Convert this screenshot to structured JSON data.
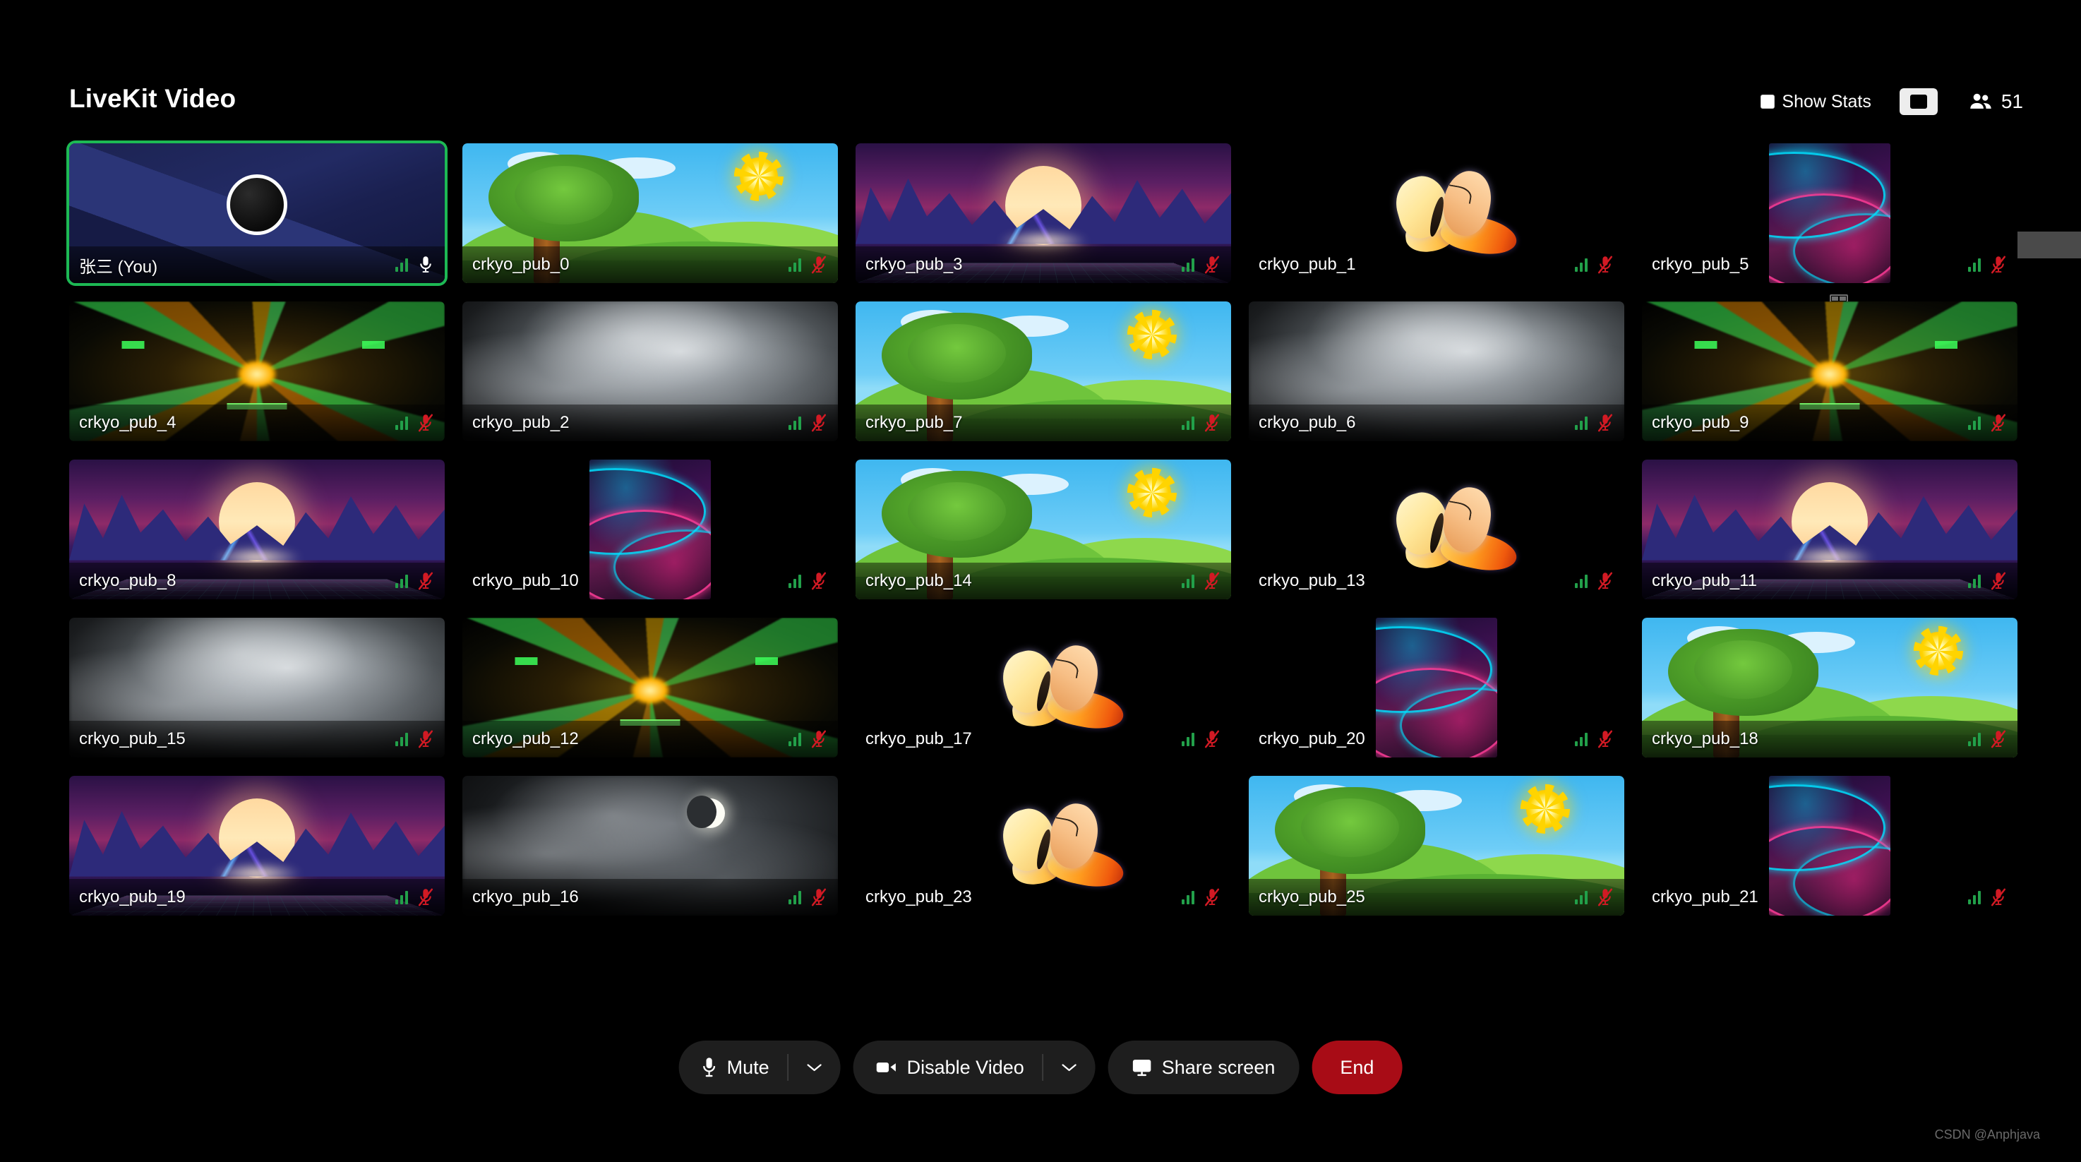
{
  "header": {
    "app_title": "LiveKit Video",
    "show_stats_label": "Show Stats",
    "show_stats_checked": false,
    "layout_grid_name": "grid-layout",
    "layout_speaker_name": "speaker-layout",
    "participant_count": "51"
  },
  "tiles": [
    {
      "name": "张三 (You)",
      "scene": "obs",
      "muted": false,
      "active": true,
      "fit": "wide"
    },
    {
      "name": "crkyo_pub_0",
      "scene": "meadow",
      "muted": true,
      "active": false,
      "fit": "wide"
    },
    {
      "name": "crkyo_pub_3",
      "scene": "synth",
      "muted": true,
      "active": false,
      "fit": "wide"
    },
    {
      "name": "crkyo_pub_1",
      "scene": "bfly",
      "muted": true,
      "active": false,
      "fit": "wide"
    },
    {
      "name": "crkyo_pub_5",
      "scene": "neon",
      "muted": true,
      "active": false,
      "fit": "narrow"
    },
    {
      "name": "crkyo_pub_4",
      "scene": "kal",
      "muted": true,
      "active": false,
      "fit": "wide"
    },
    {
      "name": "crkyo_pub_2",
      "scene": "cloud",
      "muted": true,
      "active": false,
      "fit": "wide"
    },
    {
      "name": "crkyo_pub_7",
      "scene": "meadow",
      "muted": true,
      "active": false,
      "fit": "wide"
    },
    {
      "name": "crkyo_pub_6",
      "scene": "cloud",
      "muted": true,
      "active": false,
      "fit": "wide"
    },
    {
      "name": "crkyo_pub_9",
      "scene": "kal",
      "muted": true,
      "active": false,
      "fit": "wide"
    },
    {
      "name": "crkyo_pub_8",
      "scene": "synth",
      "muted": true,
      "active": false,
      "fit": "wide"
    },
    {
      "name": "crkyo_pub_10",
      "scene": "neon",
      "muted": true,
      "active": false,
      "fit": "narrow"
    },
    {
      "name": "crkyo_pub_14",
      "scene": "meadow",
      "muted": true,
      "active": false,
      "fit": "wide"
    },
    {
      "name": "crkyo_pub_13",
      "scene": "bfly",
      "muted": true,
      "active": false,
      "fit": "wide"
    },
    {
      "name": "crkyo_pub_11",
      "scene": "synth",
      "muted": true,
      "active": false,
      "fit": "wide"
    },
    {
      "name": "crkyo_pub_15",
      "scene": "cloud",
      "muted": true,
      "active": false,
      "fit": "wide"
    },
    {
      "name": "crkyo_pub_12",
      "scene": "kal",
      "muted": true,
      "active": false,
      "fit": "wide"
    },
    {
      "name": "crkyo_pub_17",
      "scene": "bfly",
      "muted": true,
      "active": false,
      "fit": "wide"
    },
    {
      "name": "crkyo_pub_20",
      "scene": "neon",
      "muted": true,
      "active": false,
      "fit": "narrow"
    },
    {
      "name": "crkyo_pub_18",
      "scene": "meadow",
      "muted": true,
      "active": false,
      "fit": "wide"
    },
    {
      "name": "crkyo_pub_19",
      "scene": "synth",
      "muted": true,
      "active": false,
      "fit": "wide"
    },
    {
      "name": "crkyo_pub_16",
      "scene": "moon",
      "muted": true,
      "active": false,
      "fit": "wide"
    },
    {
      "name": "crkyo_pub_23",
      "scene": "bfly",
      "muted": true,
      "active": false,
      "fit": "wide"
    },
    {
      "name": "crkyo_pub_25",
      "scene": "meadow",
      "muted": true,
      "active": false,
      "fit": "wide"
    },
    {
      "name": "crkyo_pub_21",
      "scene": "neon",
      "muted": true,
      "active": false,
      "fit": "narrow"
    }
  ],
  "controls": {
    "mute_label": "Mute",
    "disable_video_label": "Disable Video",
    "share_screen_label": "Share screen",
    "end_label": "End",
    "end_color": "#a80c16"
  },
  "watermark": "CSDN @Anphjava"
}
